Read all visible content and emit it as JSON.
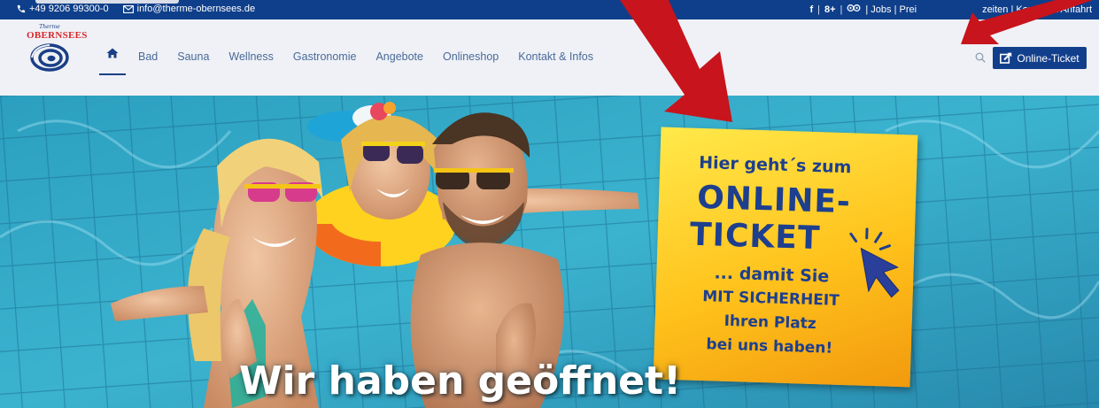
{
  "topbar": {
    "phone": "+49 9206 99300-0",
    "email": "info@therme-obernsees.de",
    "facebook_label": "f",
    "googleplus_label": "8+",
    "links_text": "| Jobs | Prei",
    "links_text_end": "zeiten | Kontakt & Anfahrt"
  },
  "logo": {
    "small": "Therme",
    "brand": "OBERNSEES"
  },
  "nav": {
    "items": [
      "Bad",
      "Sauna",
      "Wellness",
      "Gastronomie",
      "Angebote",
      "Onlineshop",
      "Kontakt & Infos"
    ],
    "ticket_label": "Online-Ticket"
  },
  "hero": {
    "headline": "Wir haben geöffnet!",
    "poster": {
      "line1": "Hier geht´s zum",
      "line2": "ONLINE-",
      "line3": "TICKET",
      "line4": "... damit Sie",
      "line5": "MIT SICHERHEIT",
      "line6": "Ihren Platz",
      "line7": "bei uns haben!"
    }
  },
  "colors": {
    "topbar": "#0f3f8a",
    "nav_bg": "#eff1f6",
    "nav_text": "#4a6a99",
    "button": "#123f8c",
    "poster_text": "#1e3f8e",
    "arrow": "#c8141c",
    "pool": "#2ea6c4"
  },
  "icons": [
    "phone-icon",
    "mail-icon",
    "facebook-icon",
    "googleplus-icon",
    "tripadvisor-icon",
    "home-icon",
    "search-icon",
    "external-link-icon",
    "pointer-arrow-icon"
  ]
}
